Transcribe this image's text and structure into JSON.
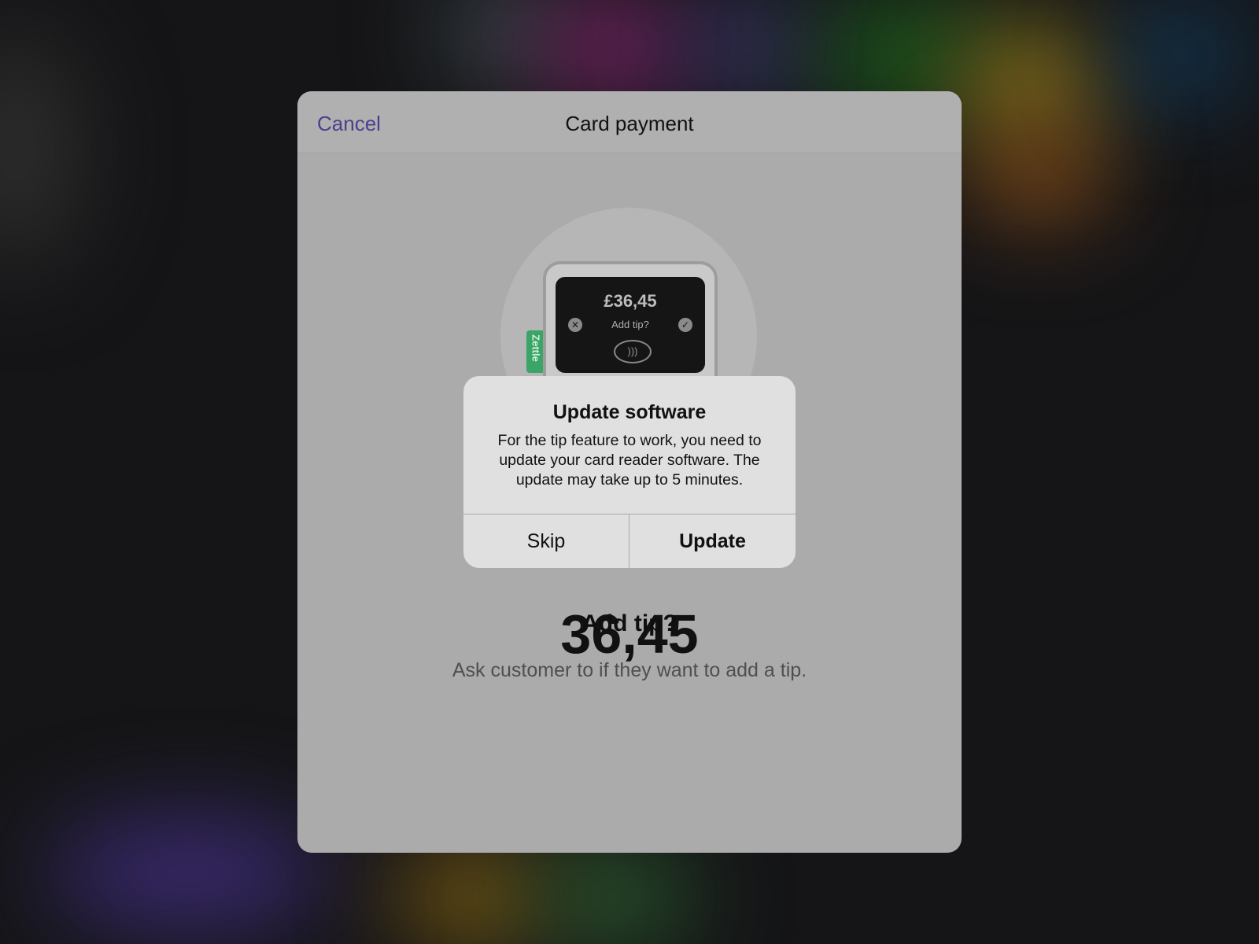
{
  "sheet": {
    "title": "Card payment",
    "cancel_label": "Cancel"
  },
  "reader": {
    "brand": "Zettle",
    "screen_amount": "£36,45",
    "screen_prompt": "Add tip?"
  },
  "content": {
    "amount_partial": "36,45",
    "heading": "Add tip?",
    "subtitle": "Ask customer to if they want to add a tip."
  },
  "alert": {
    "title": "Update software",
    "message": "For the tip feature to work, you need to update your card reader software. The update may take up to 5 minutes.",
    "skip_label": "Skip",
    "update_label": "Update"
  },
  "colors": {
    "accent": "#4a3f8c",
    "brand_green": "#3aa566"
  },
  "icons": {
    "reader_cancel": "close-icon",
    "reader_confirm": "check-icon",
    "contactless": "contactless-icon"
  }
}
